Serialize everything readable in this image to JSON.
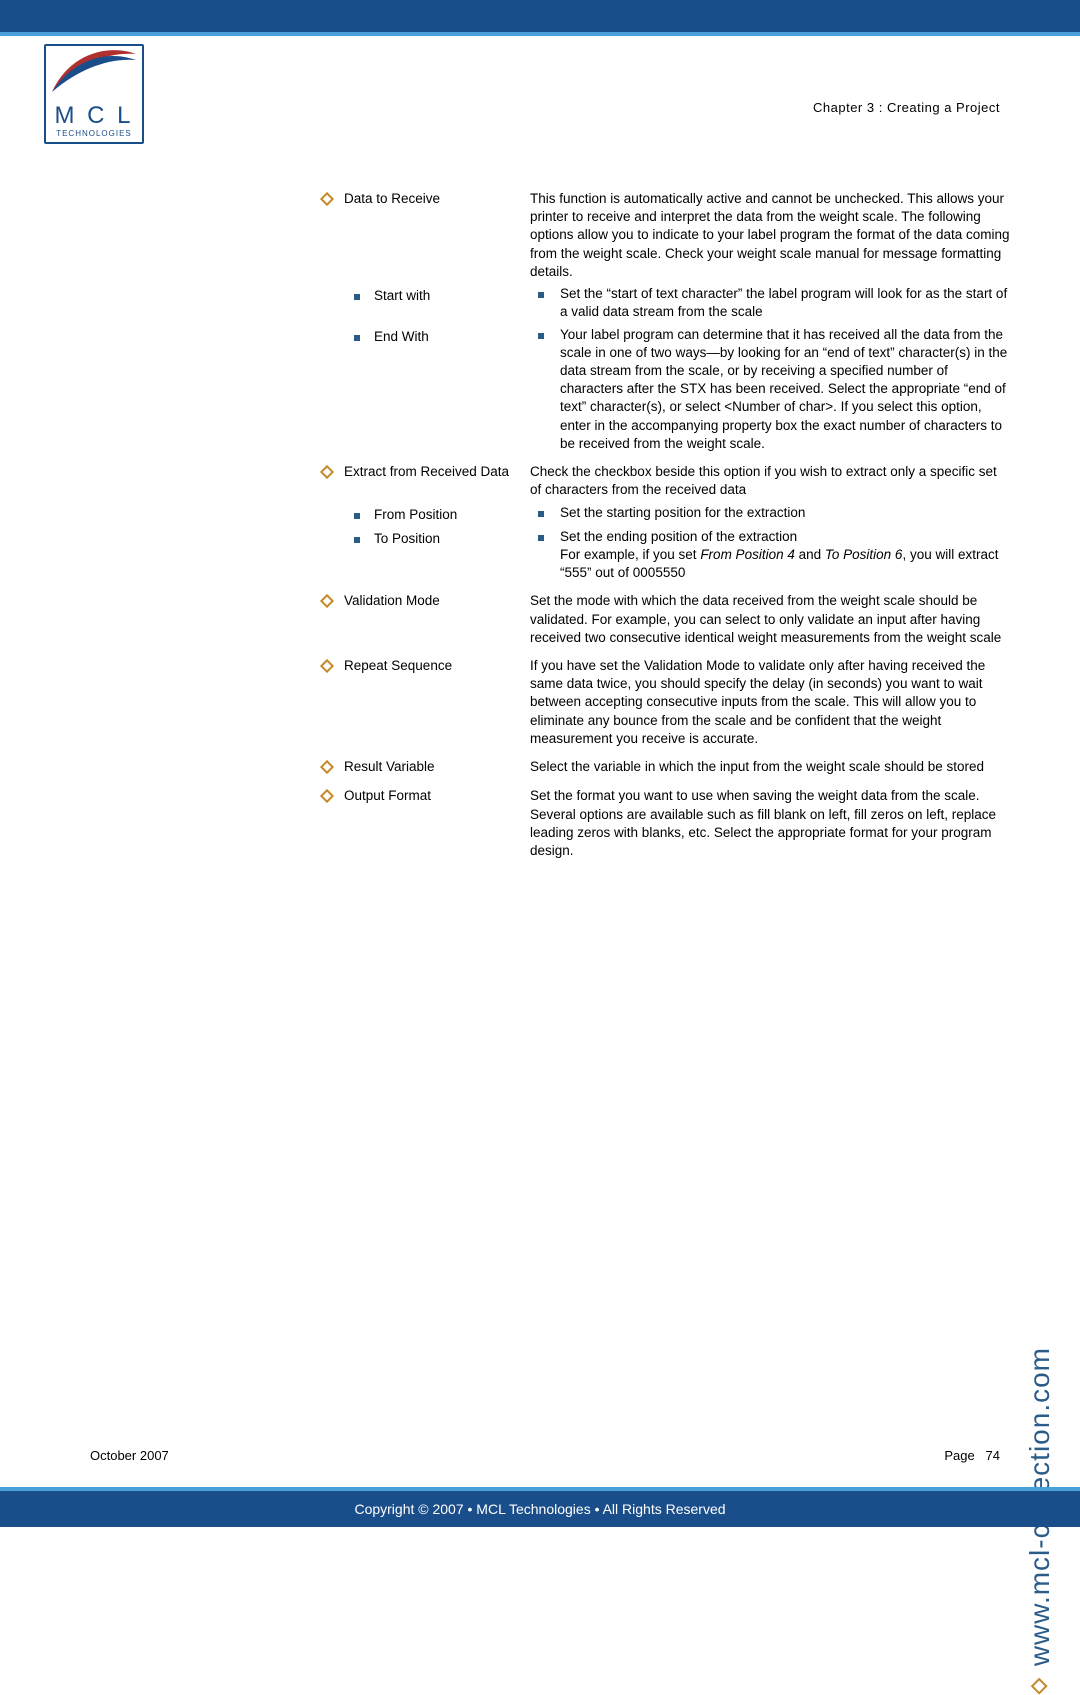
{
  "header": {
    "chapter": "Chapter 3 : Creating a Project",
    "logo_letters": "M C L",
    "logo_sub": "TECHNOLOGIES"
  },
  "sections": [
    {
      "label": "Data to Receive",
      "desc": "This function is automatically active and cannot be unchecked. This allows your printer to receive and interpret the data from the weight scale. The following options allow you to indicate to your label program the format of the data coming from the weight scale. Check your weight scale manual for message formatting details.",
      "subs": [
        {
          "label": "Start with",
          "desc": "Set the “start of text character” the label program will look for as the start of a valid data stream from the scale"
        },
        {
          "label": "End With",
          "desc": "Your label program can determine that it has received all the data from the scale in one of two ways—by looking for an “end of text” character(s) in the data stream from the scale, or by receiving a specified number of characters after the STX has been received. Select the appropriate “end of text” character(s), or select <Number of char>. If you select this option, enter in the accompanying property box the exact number of characters to be received from the weight scale."
        }
      ]
    },
    {
      "label": "Extract from Received Data",
      "desc": "Check the checkbox beside this option if you wish to extract only a specific set of characters from the received data",
      "subs": [
        {
          "label": "From Position",
          "desc": "Set the starting position for the extraction"
        },
        {
          "label": "To Position",
          "desc": "Set the ending position of the extraction",
          "extra_pre": "For example, if you set ",
          "extra_em1": "From Position 4",
          "extra_mid": " and ",
          "extra_em2": "To Position 6",
          "extra_post": ", you will extract “555” out of 0005550"
        }
      ]
    },
    {
      "label": "Validation Mode",
      "desc": "Set the mode with which the data received from the weight scale should be validated. For example, you can select to only validate an input after having received two consecutive identical weight measurements from the weight scale"
    },
    {
      "label": "Repeat Sequence",
      "desc": "If you have set the Validation Mode to validate only after having received the same data twice, you should specify the delay (in seconds) you want to wait between accepting consecutive inputs from the scale. This will allow you to eliminate any bounce from the scale and be confident that the weight measurement you receive is accurate."
    },
    {
      "label": "Result Variable",
      "desc": "Select the variable in which the input from the weight scale should be stored"
    },
    {
      "label": "Output Format",
      "desc": "Set the format you want to use when saving the weight data from the scale. Several options are available such as fill blank on left, fill zeros on left, replace leading zeros with blanks, etc. Select the appropriate format for your program design."
    }
  ],
  "side_url": "www.mcl-collection.com",
  "footer": {
    "date": "October 2007",
    "page_label": "Page",
    "page_num": "74",
    "copyright": "Copyright © 2007 • MCL Technologies • All Rights Reserved"
  }
}
